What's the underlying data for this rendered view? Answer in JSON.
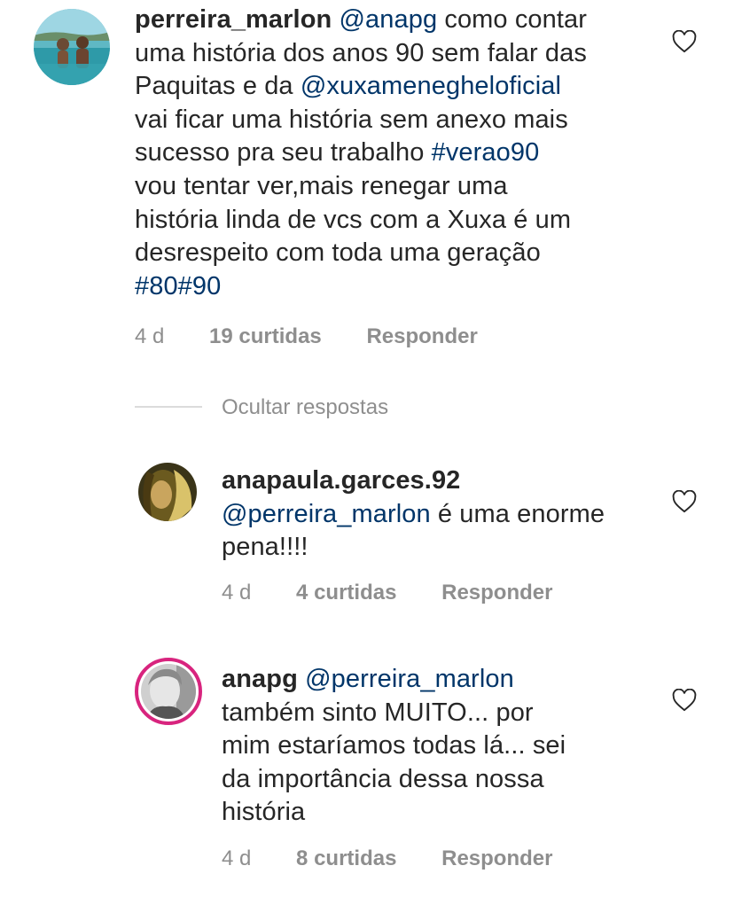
{
  "comment_main": {
    "username": "perreira_marlon",
    "lines": [
      [
        {
          "t": "mention",
          "v": "@anapg"
        },
        {
          "t": "text",
          "v": " como contar"
        }
      ],
      [
        {
          "t": "text",
          "v": "uma história dos anos 90 sem falar das"
        }
      ],
      [
        {
          "t": "text",
          "v": "Paquitas e da "
        },
        {
          "t": "mention",
          "v": "@xuxameneghelof​icial"
        }
      ],
      [
        {
          "t": "text",
          "v": "vai ficar uma história sem anexo mais"
        }
      ],
      [
        {
          "t": "text",
          "v": "sucesso pra seu trabalho "
        },
        {
          "t": "tag",
          "v": "#verao90"
        }
      ],
      [
        {
          "t": "text",
          "v": "vou tentar ver,mais renegar uma"
        }
      ],
      [
        {
          "t": "text",
          "v": "história linda de vcs com a Xuxa é um"
        }
      ],
      [
        {
          "t": "text",
          "v": "desrespeito com toda uma geração"
        }
      ],
      [
        {
          "t": "tag",
          "v": "#80#90"
        }
      ]
    ],
    "time": "4 d",
    "likes": "19 curtidas",
    "reply": "Responder"
  },
  "hide_replies": "Ocultar respostas",
  "reply_1": {
    "username": "anapaula.garces.92",
    "lines": [
      [
        {
          "t": "mention",
          "v": "@perreira_marlon"
        },
        {
          "t": "text",
          "v": " é uma enorme"
        }
      ],
      [
        {
          "t": "text",
          "v": "pena!!!!"
        }
      ]
    ],
    "time": "4 d",
    "likes": "4 curtidas",
    "reply": "Responder"
  },
  "reply_2": {
    "username": "anapg",
    "first_line_rest": [
      {
        "t": "text",
        "v": " "
      },
      {
        "t": "mention",
        "v": "@perreira_marlon"
      }
    ],
    "lines": [
      [
        {
          "t": "text",
          "v": "também sinto MUITO... por"
        }
      ],
      [
        {
          "t": "text",
          "v": "mim estaríamos todas lá... sei"
        }
      ],
      [
        {
          "t": "text",
          "v": "da importância dessa nossa"
        }
      ],
      [
        {
          "t": "text",
          "v": "história"
        }
      ]
    ],
    "time": "4 d",
    "likes": "8 curtidas",
    "reply": "Responder"
  },
  "icons": {
    "like": "heart-outline-icon"
  },
  "colors": {
    "mention": "#003569",
    "meta": "#8e8e8e",
    "story_ring": "#d8247e"
  }
}
